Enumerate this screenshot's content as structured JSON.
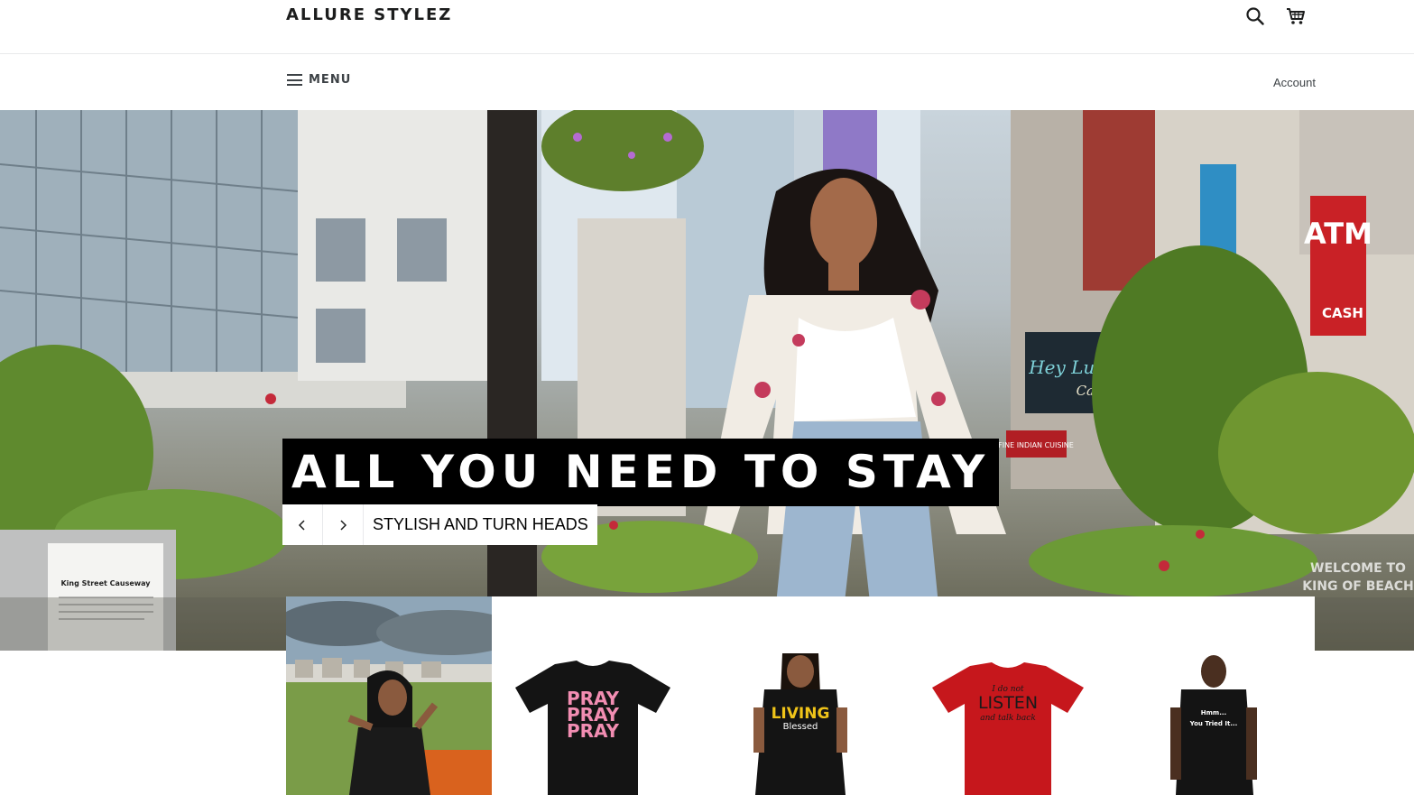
{
  "store": {
    "name": "ALLURE STYLEZ"
  },
  "header": {
    "search_icon": "search-icon",
    "cart_icon": "cart-icon"
  },
  "nav": {
    "menu_label": "MENU",
    "account_label": "Account"
  },
  "hero": {
    "title": "ALL YOU NEED TO STAY",
    "subtitle": "STYLISH AND TURN HEADS",
    "background_text": {
      "plaque_title": "King Street Causeway",
      "atm_line1": "ATM",
      "atm_line2": "CASH",
      "cafe_name": "Hey Lucy",
      "cafe_word": "Cafe",
      "restaurant_sign": "FINE INDIAN CUISINE",
      "welcome_sign": "WELCOME TO KING OF BEACH"
    }
  },
  "products": [
    {
      "name": "pray-tshirt",
      "print": [
        "PRAY",
        "PRAY",
        "PRAY"
      ],
      "shirt_color": "#141414",
      "print_color": "#f28db2"
    },
    {
      "name": "living-blessed-tshirt",
      "print": [
        "LIVING",
        "Blessed"
      ],
      "shirt_color": "#141414",
      "print_color": "#f0c419"
    },
    {
      "name": "listen-tshirt",
      "print": [
        "I do not",
        "LISTEN",
        "and talk back"
      ],
      "shirt_color": "#c6171c",
      "print_color": "#1a1a1a"
    },
    {
      "name": "hmm-tshirt",
      "print": [
        "Hmm...",
        "You Tried It..."
      ],
      "shirt_color": "#141414",
      "print_color": "#ffffff"
    }
  ],
  "colors": {
    "accent": "#000000",
    "text": "#1c1d1d",
    "divider": "#e8e9eb"
  }
}
